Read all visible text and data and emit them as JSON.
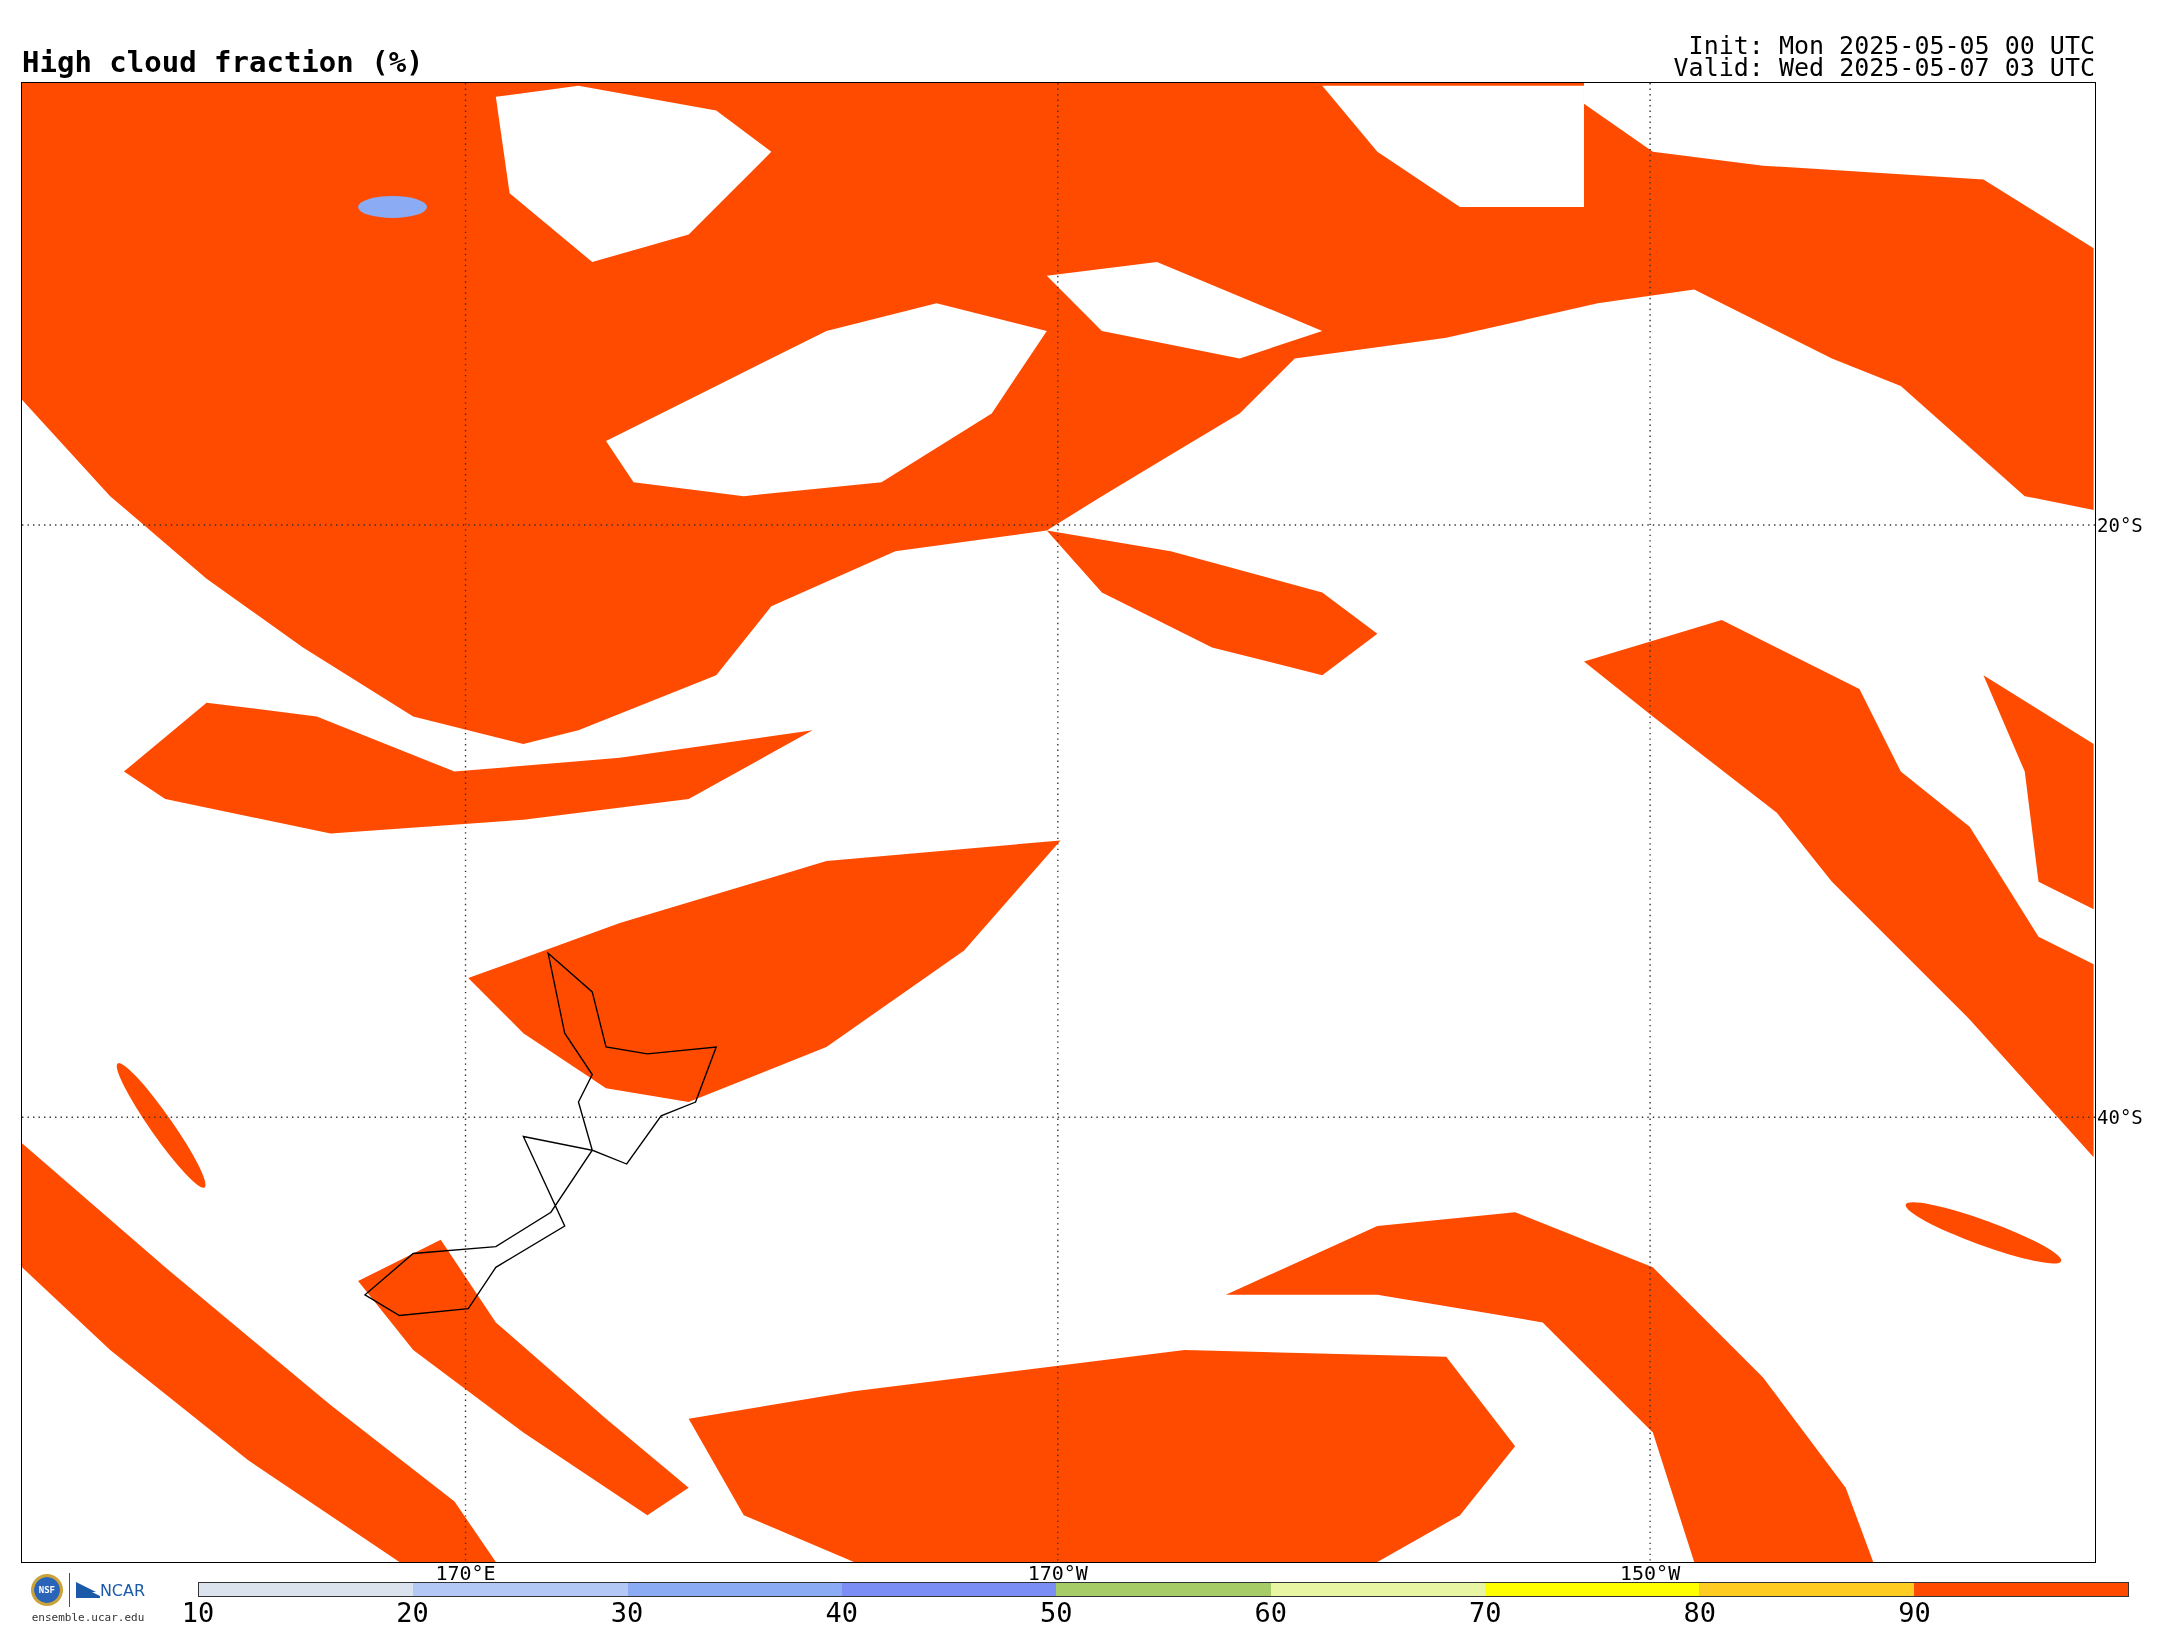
{
  "title": "High cloud fraction (%)",
  "init": "Init: Mon 2025-05-05 00 UTC",
  "valid": "Valid: Wed 2025-05-07 03 UTC",
  "map": {
    "lat_labels": [
      "20°S",
      "40°S"
    ],
    "lon_labels": [
      "170°E",
      "170°W",
      "150°W"
    ]
  },
  "colorbar": {
    "ticks": [
      "10",
      "20",
      "30",
      "40",
      "50",
      "60",
      "70",
      "80",
      "90"
    ],
    "bins": [
      {
        "color": "#dbe4ee"
      },
      {
        "color": "#b4c8f5"
      },
      {
        "color": "#8cabf5"
      },
      {
        "color": "#7b8ef5"
      },
      {
        "color": "#a5cc66"
      },
      {
        "color": "#e8f5a3"
      },
      {
        "color": "#ffff00"
      },
      {
        "color": "#ffcc22"
      },
      {
        "color": "#ff4b00"
      }
    ]
  },
  "credits": {
    "nsf": "NSF",
    "ncar": "NCAR",
    "url": "ensemble.ucar.edu"
  }
}
